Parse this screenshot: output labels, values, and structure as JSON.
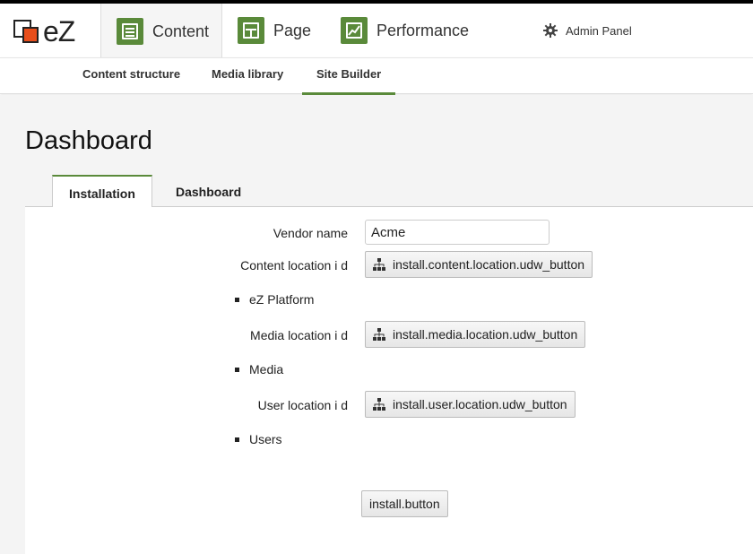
{
  "logo": {
    "text": "eZ"
  },
  "zones": [
    {
      "label": "Content",
      "icon": "content-icon"
    },
    {
      "label": "Page",
      "icon": "page-icon"
    },
    {
      "label": "Performance",
      "icon": "performance-icon"
    }
  ],
  "admin": {
    "label": "Admin Panel",
    "icon": "gear-icon"
  },
  "subnav": [
    {
      "label": "Content structure"
    },
    {
      "label": "Media library"
    },
    {
      "label": "Site Builder"
    }
  ],
  "page": {
    "title": "Dashboard"
  },
  "tabs": [
    {
      "label": "Installation"
    },
    {
      "label": "Dashboard"
    }
  ],
  "form": {
    "vendor_label": "Vendor name",
    "vendor_value": "Acme",
    "content_label": "Content location i d",
    "content_button": "install.content.location.udw_button",
    "content_selected": "eZ Platform",
    "media_label": "Media location i d",
    "media_button": "install.media.location.udw_button",
    "media_selected": "Media",
    "user_label": "User location i d",
    "user_button": "install.user.location.udw_button",
    "user_selected": "Users",
    "install_button": "install.button"
  },
  "colors": {
    "accent": "#5a8a3a",
    "logo_orange": "#e84e1b"
  }
}
